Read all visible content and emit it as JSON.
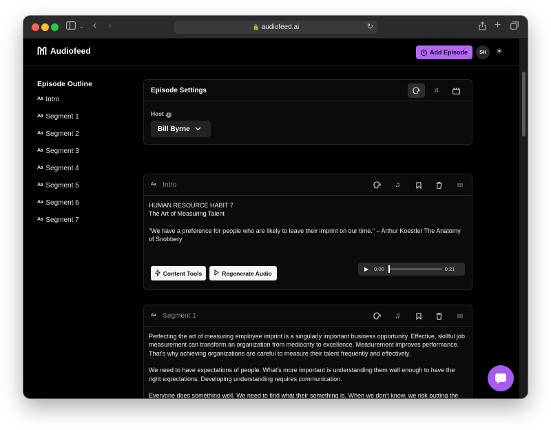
{
  "browser": {
    "url": "audiofeed.ai"
  },
  "app": {
    "brand": "Audiofeed",
    "add_episode_label": "Add Episode",
    "avatar_initials": "SH",
    "accent_color": "#b069f0"
  },
  "sidebar": {
    "title": "Episode Outline",
    "icon_text": "Aa",
    "items": [
      {
        "label": "Intro"
      },
      {
        "label": "Segment 1"
      },
      {
        "label": "Segment 2"
      },
      {
        "label": "Segment 3"
      },
      {
        "label": "Segment 4"
      },
      {
        "label": "Segment 5"
      },
      {
        "label": "Segment 6"
      },
      {
        "label": "Segment 7"
      }
    ]
  },
  "settings": {
    "title": "Episode Settings",
    "host_label": "Host",
    "host_value": "Bill Byrne"
  },
  "intro": {
    "name": "Intro",
    "lines": [
      "HUMAN RESOURCE HABIT 7",
      "The Art of Measuring Talent"
    ],
    "quote": "\"We have a preference for people who are likely to leave their imprint on our time.\" – Arthur Koestler The Anatomy of Snobbery",
    "content_tools_label": "Content Tools",
    "regenerate_label": "Regenerate Audio",
    "audio": {
      "current_time": "0:00",
      "duration": "0:21",
      "progress": 0
    }
  },
  "segment1": {
    "name": "Segment 1",
    "paragraphs": [
      "Perfecting the art of measuring employee imprint is a singularly important business opportunity. Effective, skillful job measurement can transform an organization from mediocrity to excellence. Measurement improves performance. That's why achieving organizations are careful to measure their talent frequently and effectively.",
      "We need to have expectations of people. What's more important is understanding them well enough to have the right expectations. Developing understanding requires communication.",
      "Everyone does something well. We need to find what their something is. When we don't know, we risk putting the right people in the wrong slot. This not only reduces the employee's opportunity for growth but the organization's profit."
    ]
  }
}
